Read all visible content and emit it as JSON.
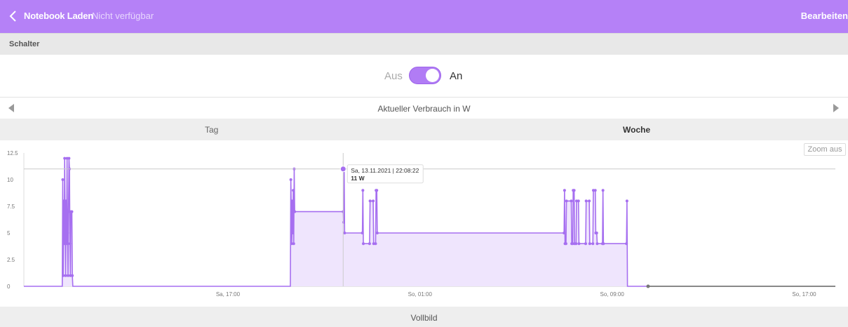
{
  "header": {
    "title": "Notebook Laden",
    "subtitle": "Nicht verfügbar",
    "edit_label": "Bearbeiten",
    "back_icon": "chevron-left-icon"
  },
  "section": {
    "label": "Schalter"
  },
  "toggle": {
    "off_label": "Aus",
    "on_label": "An",
    "state": "on"
  },
  "chart_header": {
    "title": "Aktueller Verbrauch in W"
  },
  "tabs": [
    {
      "label": "Tag",
      "active": false
    },
    {
      "label": "Woche",
      "active": true
    }
  ],
  "zoom_label": "Zoom aus",
  "footer": {
    "label": "Vollbild"
  },
  "tooltip": {
    "time": "Sa, 13.11.2021 | 22:08:22",
    "value": "11 W"
  },
  "colors": {
    "accent": "#b581f7",
    "line": "#a66ff0",
    "fill": "#efe5fd"
  },
  "chart_data": {
    "type": "area",
    "title": "Aktueller Verbrauch in W",
    "ylim": [
      0,
      12.5
    ],
    "y_ticks": [
      0,
      2.5,
      5,
      7.5,
      10,
      12.5
    ],
    "y_tick_labels": [
      "0",
      "2.5",
      "5",
      "7.5",
      "10",
      "12.5"
    ],
    "x_ticks": [
      {
        "label": "Sa, 17:00",
        "hours": 17
      },
      {
        "label": "So, 01:00",
        "hours": 25
      },
      {
        "label": "So, 09:00",
        "hours": 33
      },
      {
        "label": "So, 17:00",
        "hours": 41
      }
    ],
    "xlim_hours": [
      8.5,
      42.3
    ],
    "crosshair": {
      "hours": 21.8,
      "value": 11
    },
    "points": [
      [
        8.5,
        0
      ],
      [
        10.1,
        0
      ],
      [
        10.12,
        10
      ],
      [
        10.14,
        1
      ],
      [
        10.16,
        8
      ],
      [
        10.18,
        4
      ],
      [
        10.2,
        12
      ],
      [
        10.22,
        6
      ],
      [
        10.24,
        1
      ],
      [
        10.26,
        8
      ],
      [
        10.28,
        4
      ],
      [
        10.3,
        12
      ],
      [
        10.32,
        5
      ],
      [
        10.34,
        1
      ],
      [
        10.36,
        7
      ],
      [
        10.38,
        12
      ],
      [
        10.4,
        11
      ],
      [
        10.42,
        4
      ],
      [
        10.44,
        1
      ],
      [
        10.46,
        7
      ],
      [
        10.5,
        7
      ],
      [
        10.52,
        1
      ],
      [
        10.54,
        0
      ],
      [
        19.6,
        0
      ],
      [
        19.62,
        10
      ],
      [
        19.66,
        4
      ],
      [
        19.68,
        8
      ],
      [
        19.7,
        5
      ],
      [
        19.72,
        9
      ],
      [
        19.74,
        4
      ],
      [
        19.76,
        11
      ],
      [
        19.78,
        7
      ],
      [
        21.8,
        7
      ],
      [
        21.82,
        6
      ],
      [
        21.84,
        11
      ],
      [
        21.86,
        5
      ],
      [
        22.6,
        5
      ],
      [
        22.62,
        9
      ],
      [
        22.64,
        4
      ],
      [
        22.9,
        4
      ],
      [
        22.92,
        8
      ],
      [
        23.05,
        8
      ],
      [
        23.07,
        4
      ],
      [
        23.15,
        4
      ],
      [
        23.17,
        9
      ],
      [
        23.2,
        9
      ],
      [
        23.22,
        5
      ],
      [
        31.0,
        5
      ],
      [
        31.02,
        9
      ],
      [
        31.04,
        4
      ],
      [
        31.08,
        4
      ],
      [
        31.1,
        8
      ],
      [
        31.3,
        8
      ],
      [
        31.32,
        4
      ],
      [
        31.36,
        4
      ],
      [
        31.38,
        9
      ],
      [
        31.42,
        9
      ],
      [
        31.44,
        4
      ],
      [
        31.5,
        4
      ],
      [
        31.52,
        8
      ],
      [
        31.6,
        8
      ],
      [
        31.62,
        4
      ],
      [
        31.9,
        4
      ],
      [
        31.92,
        8
      ],
      [
        32.05,
        8
      ],
      [
        32.07,
        4
      ],
      [
        32.2,
        4
      ],
      [
        32.22,
        9
      ],
      [
        32.3,
        9
      ],
      [
        32.32,
        5
      ],
      [
        32.36,
        5
      ],
      [
        32.38,
        4
      ],
      [
        32.6,
        4
      ],
      [
        32.62,
        9
      ],
      [
        32.64,
        4
      ],
      [
        33.6,
        4
      ],
      [
        33.62,
        8
      ],
      [
        33.64,
        0
      ],
      [
        34.5,
        0
      ],
      [
        42.3,
        0
      ]
    ]
  }
}
